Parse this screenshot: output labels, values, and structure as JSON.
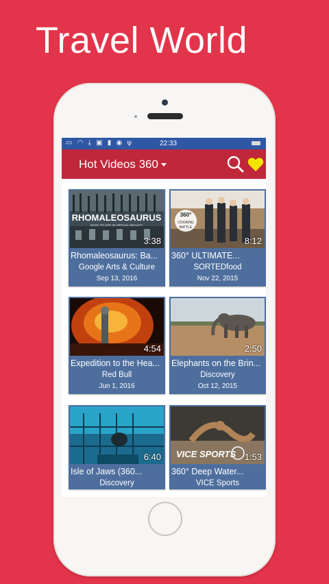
{
  "headline": "Travel World",
  "status_bar": {
    "time": "22:33",
    "icons": [
      "sim-icon",
      "wifi-icon",
      "download-icon",
      "image-icon",
      "battery-icon",
      "android-icon",
      "usb-icon"
    ]
  },
  "app_bar": {
    "title": "Hot Videos 360",
    "dropdown_icon": "caret-down-icon",
    "search_icon": "search-icon",
    "favorites_icon": "heart-icon",
    "favorites_color": "#f5e400"
  },
  "colors": {
    "background": "#e2344a",
    "app_bar": "#c0273a",
    "status_bar": "#2f57a4",
    "card": "#4e6f9e"
  },
  "videos": [
    {
      "title": "Rhomaleosaurus: Ba...",
      "channel": "Google Arts & Culture",
      "date": "Sep 13, 2016",
      "duration": "3:38",
      "thumb_text": "RHOMALEOSAURUS",
      "thumb_sub": "BACK TO LIFE IN VIRTUAL REALITY"
    },
    {
      "title": "360° ULTIMATE...",
      "channel": "SORTEDfood",
      "date": "Nov 22, 2015",
      "duration": "8:12",
      "thumb_text": "360° COOKING BATTLE"
    },
    {
      "title": "Expedition to the Hea...",
      "channel": "Red Bull",
      "date": "Jun 1, 2016",
      "duration": "4:54"
    },
    {
      "title": "Elephants on the Brin...",
      "channel": "Discovery",
      "date": "Oct 12, 2015",
      "duration": "2:50"
    },
    {
      "title": "Isle of Jaws (360...",
      "channel": "Discovery",
      "date": "",
      "duration": "6:40"
    },
    {
      "title": "360° Deep Water...",
      "channel": "VICE Sports",
      "date": "",
      "duration": "1:53",
      "thumb_text": "VICE SPORTS"
    }
  ]
}
